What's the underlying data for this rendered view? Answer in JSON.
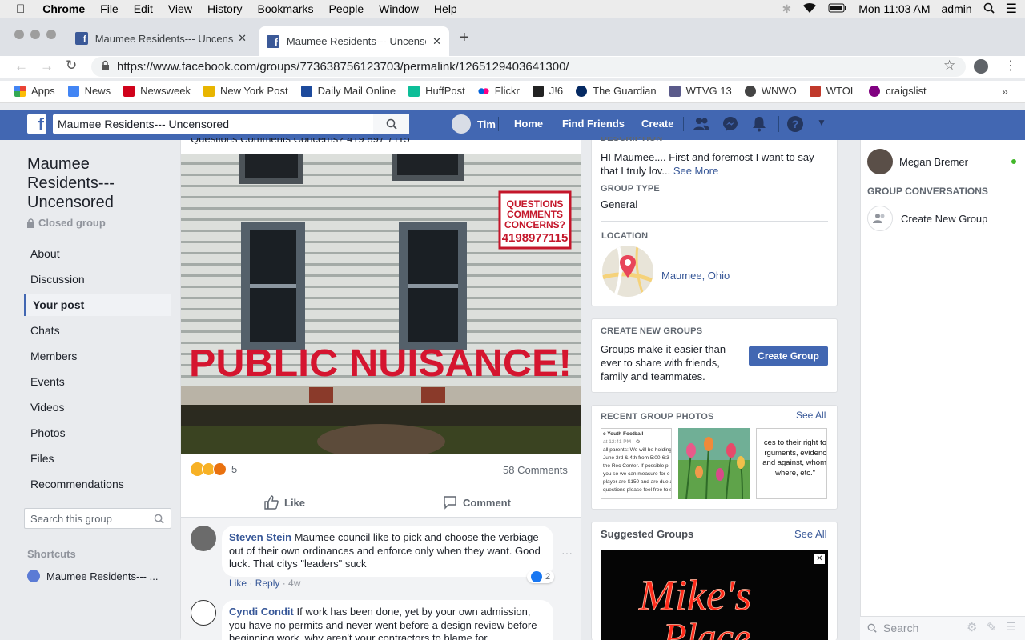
{
  "menubar": {
    "app": "Chrome",
    "items": [
      "File",
      "Edit",
      "View",
      "History",
      "Bookmarks",
      "People",
      "Window",
      "Help"
    ],
    "clock": "Mon 11:03 AM",
    "user": "admin"
  },
  "tabs": [
    {
      "title": "Maumee Residents--- Uncenso"
    },
    {
      "title": "Maumee Residents--- Uncenso"
    }
  ],
  "url": "https://www.facebook.com/groups/773638756123703/permalink/1265129403641300/",
  "bookmarks": [
    {
      "label": "Apps",
      "color": "#ea4335"
    },
    {
      "label": "News",
      "color": "#4285f4"
    },
    {
      "label": "Newsweek",
      "color": "#d0021b"
    },
    {
      "label": "New York Post",
      "color": "#e8b500"
    },
    {
      "label": "Daily Mail Online",
      "color": "#1d4a9c"
    },
    {
      "label": "HuffPost",
      "color": "#0dbe98"
    },
    {
      "label": "Flickr",
      "color": "#ff0084"
    },
    {
      "label": "J!6",
      "color": "#222222"
    },
    {
      "label": "The Guardian",
      "color": "#052962"
    },
    {
      "label": "WTVG 13",
      "color": "#5a5a8a"
    },
    {
      "label": "WNWO",
      "color": "#444444"
    },
    {
      "label": "WTOL",
      "color": "#c0392b"
    },
    {
      "label": "craigslist",
      "color": "#800080"
    }
  ],
  "fb": {
    "search_value": "Maumee Residents--- Uncensored",
    "user": "Tim",
    "nav": [
      "Home",
      "Find Friends",
      "Create"
    ]
  },
  "group": {
    "name_lines": [
      "Maumee",
      "Residents---",
      "Uncensored"
    ],
    "privacy": "Closed group",
    "nav": [
      "About",
      "Discussion",
      "Your post",
      "Chats",
      "Members",
      "Events",
      "Videos",
      "Photos",
      "Files",
      "Recommendations"
    ],
    "search_placeholder": "Search this group",
    "shortcuts_title": "Shortcuts",
    "shortcut": "Maumee Residents--- ..."
  },
  "post": {
    "header_partial": "Questions Comments Concerns? 419 897 7115",
    "reaction_count": "5",
    "comments_count": "58 Comments",
    "like": "Like",
    "comment": "Comment",
    "sign": {
      "line1": "QUESTIONS",
      "line2": "COMMENTS",
      "line3": "CONCERNS?",
      "line4": "4198977115"
    },
    "painted": "PUBLIC NUISANCE!"
  },
  "comments": [
    {
      "author": "Steven Stein",
      "text": "Maumee council like to pick and choose the verbiage out of their own ordinances and enforce only when they want. Good luck. That citys \"leaders\" suck",
      "like": "Like",
      "reply": "Reply",
      "age": "4w",
      "reactions": "2"
    },
    {
      "author": "Cyndi Condit",
      "text": "If work has been done, yet by your own admission, you have no permits and never went before a design review before beginning work, why aren't your contractors to blame for"
    }
  ],
  "about": {
    "desc_label": "DESCRIPTION",
    "desc_text": "HI Maumee.... First and foremost I want to say that I truly lov...",
    "see_more": "See More",
    "type_label": "GROUP TYPE",
    "type_value": "General",
    "location_label": "LOCATION",
    "location_value": "Maumee, Ohio"
  },
  "create_groups": {
    "label": "CREATE NEW GROUPS",
    "text": "Groups make it easier than ever to share with friends, family and teammates.",
    "button": "Create Group"
  },
  "photos": {
    "label": "RECENT GROUP PHOTOS",
    "see_all": "See All",
    "p1": [
      "e Youth Football",
      "at 12:41 PM · ✿",
      "all parents: We will be holding",
      "June 3rd & 4th from 5:00-6:3",
      "the Rec Center. If possible p",
      "you so we can measure for e",
      "player are $150 and are due at",
      "questions please feel free to s"
    ],
    "p3": [
      "ces to their right to",
      "rguments, evidenc",
      "and against, whom",
      "where, etc.\""
    ]
  },
  "suggested": {
    "title": "Suggested Groups",
    "see_all": "See All",
    "sign_text_1": "Mike's",
    "sign_text_2": "Place"
  },
  "chat": {
    "contact": "Megan Bremer",
    "conv_label": "GROUP CONVERSATIONS",
    "create": "Create New Group",
    "search": "Search"
  }
}
